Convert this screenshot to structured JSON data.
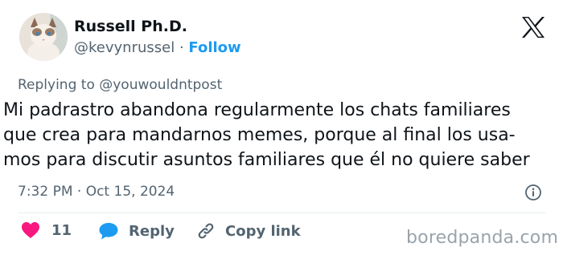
{
  "header": {
    "display_name": "Russell Ph.D.",
    "handle": "@kevynrussel",
    "separator": " · ",
    "follow_label": "Follow"
  },
  "reply_context": {
    "prefix": "Replying to ",
    "mention": "@youwouldntpost"
  },
  "tweet": {
    "lines": [
      "Mi padrastro abandona regularmente los chats familiares",
      "que crea para mandarnos memes, porque al final los usa-",
      "mos para discutir asuntos familiares que él no quiere saber"
    ],
    "timestamp": "7:32 PM · Oct 15, 2024"
  },
  "actions": {
    "like_count": "11",
    "reply_label": "Reply",
    "copy_link_label": "Copy link"
  },
  "watermark": "boredpanda.com",
  "colors": {
    "accent": "#1d9bf0",
    "like": "#f91880",
    "text": "#0f1419",
    "muted": "#536471"
  },
  "icons": {
    "platform": "x-logo-icon",
    "info": "info-icon",
    "like": "heart-icon",
    "reply": "speech-bubble-icon",
    "copy": "link-icon"
  }
}
